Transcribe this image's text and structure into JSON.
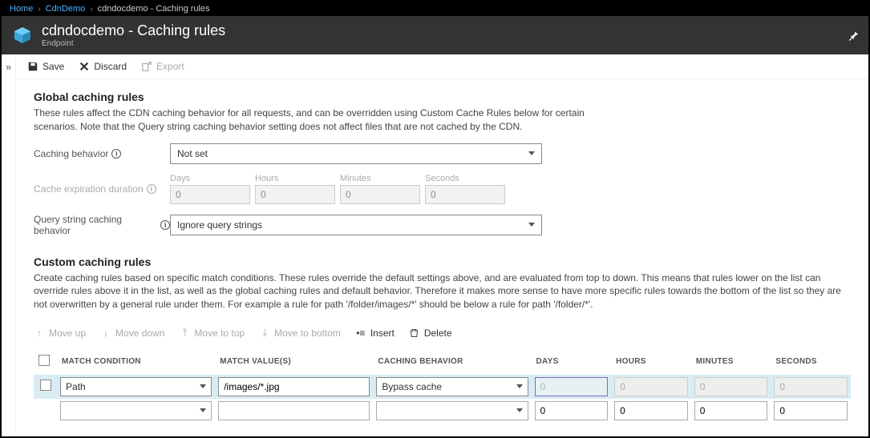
{
  "breadcrumb": {
    "items": [
      "Home",
      "CdnDemo"
    ],
    "current": "cdndocdemo - Caching rules"
  },
  "header": {
    "title": "cdndocdemo - Caching rules",
    "subtitle": "Endpoint"
  },
  "toolbar": {
    "save": "Save",
    "discard": "Discard",
    "export": "Export"
  },
  "global": {
    "title": "Global caching rules",
    "desc": "These rules affect the CDN caching behavior for all requests, and can be overridden using Custom Cache Rules below for certain scenarios. Note that the Query string caching behavior setting does not affect files that are not cached by the CDN.",
    "caching_behavior_label": "Caching behavior",
    "caching_behavior_value": "Not set",
    "expiration_label": "Cache expiration duration",
    "duration_labels": {
      "days": "Days",
      "hours": "Hours",
      "minutes": "Minutes",
      "seconds": "Seconds"
    },
    "duration_values": {
      "days": "0",
      "hours": "0",
      "minutes": "0",
      "seconds": "0"
    },
    "query_label": "Query string caching behavior",
    "query_value": "Ignore query strings"
  },
  "custom": {
    "title": "Custom caching rules",
    "desc": "Create caching rules based on specific match conditions. These rules override the default settings above, and are evaluated from top to down. This means that rules lower on the list can override rules above it in the list, as well as the global caching rules and default behavior. Therefore it makes more sense to have more specific rules towards the bottom of the list so they are not overwritten by a general rule under them. For example a rule for path '/folder/images/*' should be below a rule for path '/folder/*'."
  },
  "rules_toolbar": {
    "move_up": "Move up",
    "move_down": "Move down",
    "move_top": "Move to top",
    "move_bottom": "Move to bottom",
    "insert": "Insert",
    "delete": "Delete"
  },
  "table": {
    "headers": {
      "cond": "MATCH CONDITION",
      "val": "MATCH VALUE(S)",
      "beh": "CACHING BEHAVIOR",
      "days": "DAYS",
      "hours": "HOURS",
      "minutes": "MINUTES",
      "seconds": "SECONDS"
    },
    "rows": [
      {
        "selected": true,
        "condition": "Path",
        "value": "/images/*.jpg",
        "behavior": "Bypass cache",
        "days": "0",
        "hours": "0",
        "minutes": "0",
        "seconds": "0",
        "duration_disabled": true
      },
      {
        "selected": false,
        "condition": "",
        "value": "",
        "behavior": "",
        "days": "0",
        "hours": "0",
        "minutes": "0",
        "seconds": "0",
        "duration_disabled": false
      }
    ]
  }
}
